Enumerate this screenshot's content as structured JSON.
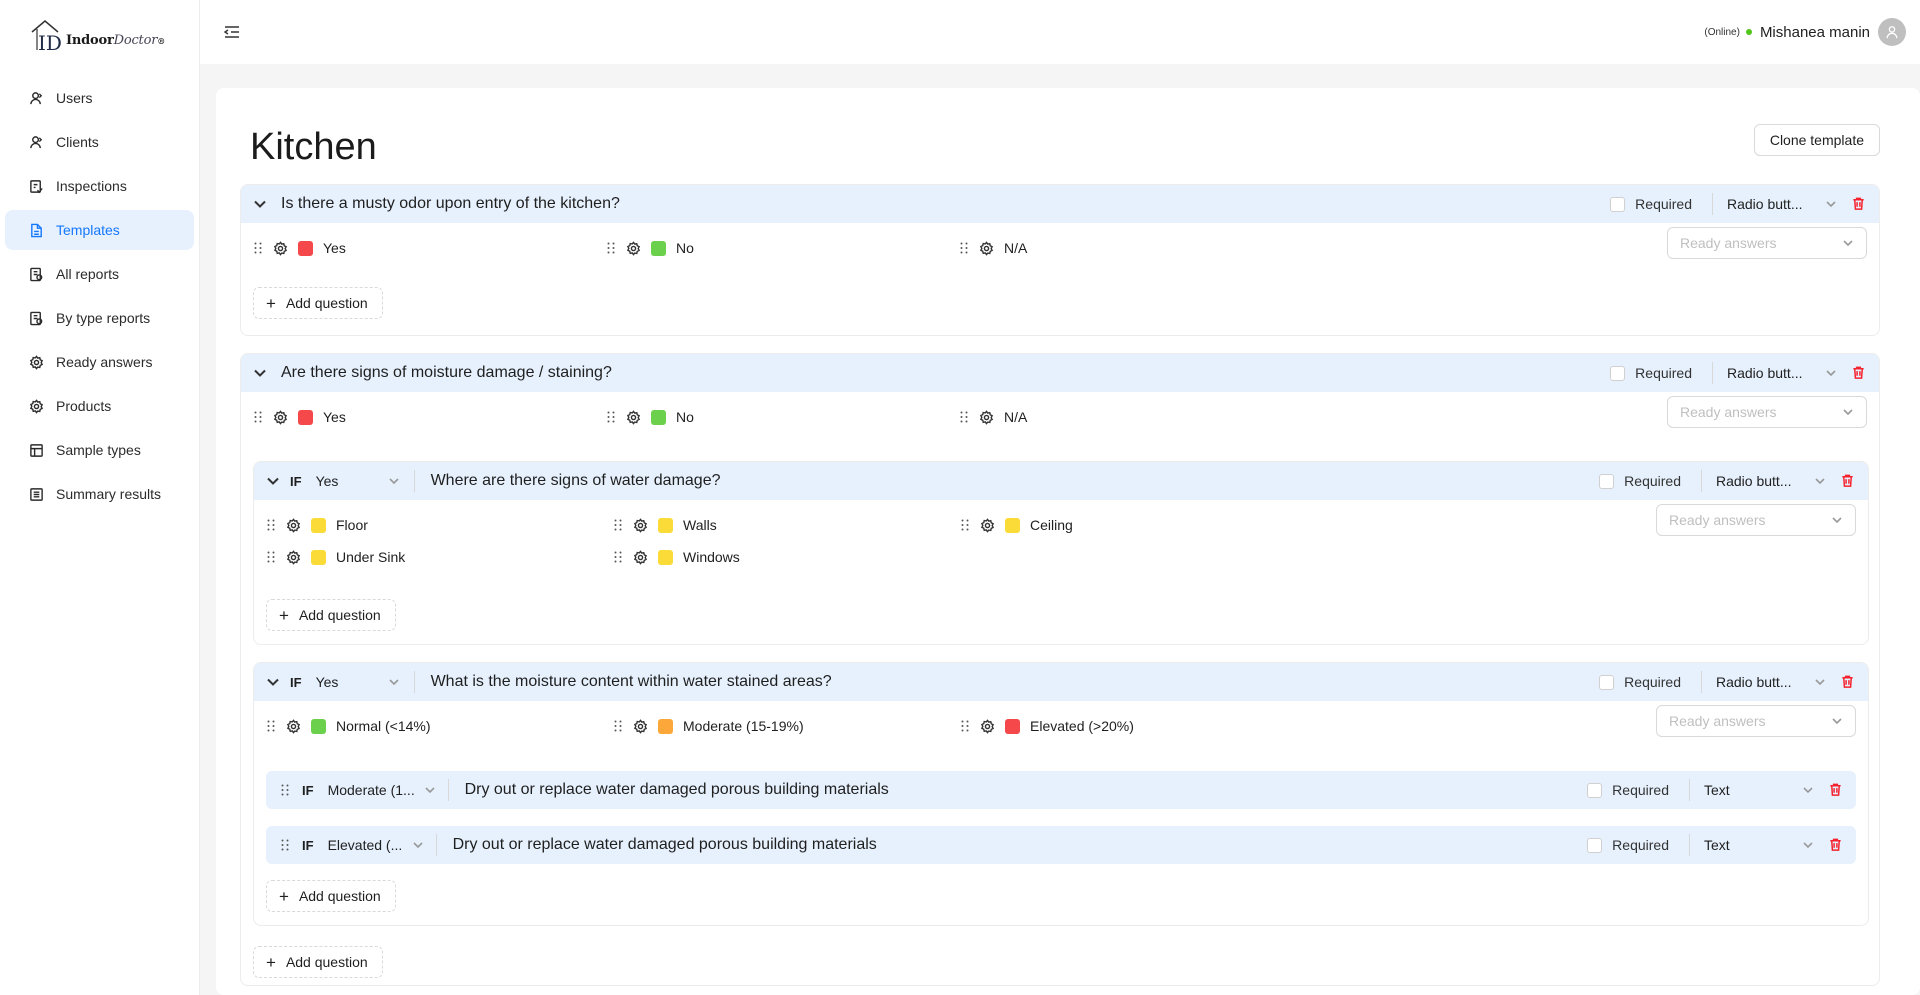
{
  "app": {
    "logo_main": "Indoor",
    "logo_doc": "Doctor",
    "logo_mark": "®"
  },
  "sidebar": {
    "items": [
      {
        "label": "Users",
        "icon": "user-icon"
      },
      {
        "label": "Clients",
        "icon": "user-icon"
      },
      {
        "label": "Inspections",
        "icon": "clipboard-check-icon"
      },
      {
        "label": "Templates",
        "icon": "document-icon",
        "active": true
      },
      {
        "label": "All reports",
        "icon": "report-icon"
      },
      {
        "label": "By type reports",
        "icon": "report-icon"
      },
      {
        "label": "Ready answers",
        "icon": "gear-icon"
      },
      {
        "label": "Products",
        "icon": "gear-icon"
      },
      {
        "label": "Sample types",
        "icon": "layout-icon"
      },
      {
        "label": "Summary results",
        "icon": "list-icon"
      }
    ]
  },
  "header": {
    "status": "(Online)",
    "username": "Mishanea manin"
  },
  "page": {
    "title": "Kitchen",
    "clone_label": "Clone template"
  },
  "common": {
    "required": "Required",
    "ready_answers": "Ready answers",
    "add_question": "Add question",
    "if_label": "IF"
  },
  "questions": [
    {
      "text": "Is there a musty odor upon entry of the kitchen?",
      "type": "Radio butt...",
      "answers": [
        {
          "label": "Yes",
          "color": "#f5484a"
        },
        {
          "label": "No",
          "color": "#6bd04c"
        },
        {
          "label": "N/A"
        }
      ]
    },
    {
      "text": "Are there signs of moisture damage / staining?",
      "type": "Radio butt...",
      "answers": [
        {
          "label": "Yes",
          "color": "#f5484a"
        },
        {
          "label": "No",
          "color": "#6bd04c"
        },
        {
          "label": "N/A"
        }
      ],
      "sub": [
        {
          "condition": "Yes",
          "text": "Where are there signs of water damage?",
          "type": "Radio butt...",
          "answers": [
            {
              "label": "Floor",
              "color": "#fadb38"
            },
            {
              "label": "Walls",
              "color": "#fadb38"
            },
            {
              "label": "Ceiling",
              "color": "#fadb38"
            },
            {
              "label": "Under Sink",
              "color": "#fadb38"
            },
            {
              "label": "Windows",
              "color": "#fadb38"
            }
          ]
        },
        {
          "condition": "Yes",
          "text": "What is the moisture content within water stained areas?",
          "type": "Radio butt...",
          "answers": [
            {
              "label": "Normal (<14%)",
              "color": "#6bd04c"
            },
            {
              "label": "Moderate (15-19%)",
              "color": "#fba73a"
            },
            {
              "label": "Elevated (>20%)",
              "color": "#f5484a"
            }
          ],
          "sub": [
            {
              "condition": "Moderate (1...",
              "text": "Dry out or replace water damaged porous building materials",
              "type": "Text"
            },
            {
              "condition": "Elevated (...",
              "text": "Dry out or replace water damaged porous building materials",
              "type": "Text"
            }
          ]
        }
      ]
    }
  ]
}
